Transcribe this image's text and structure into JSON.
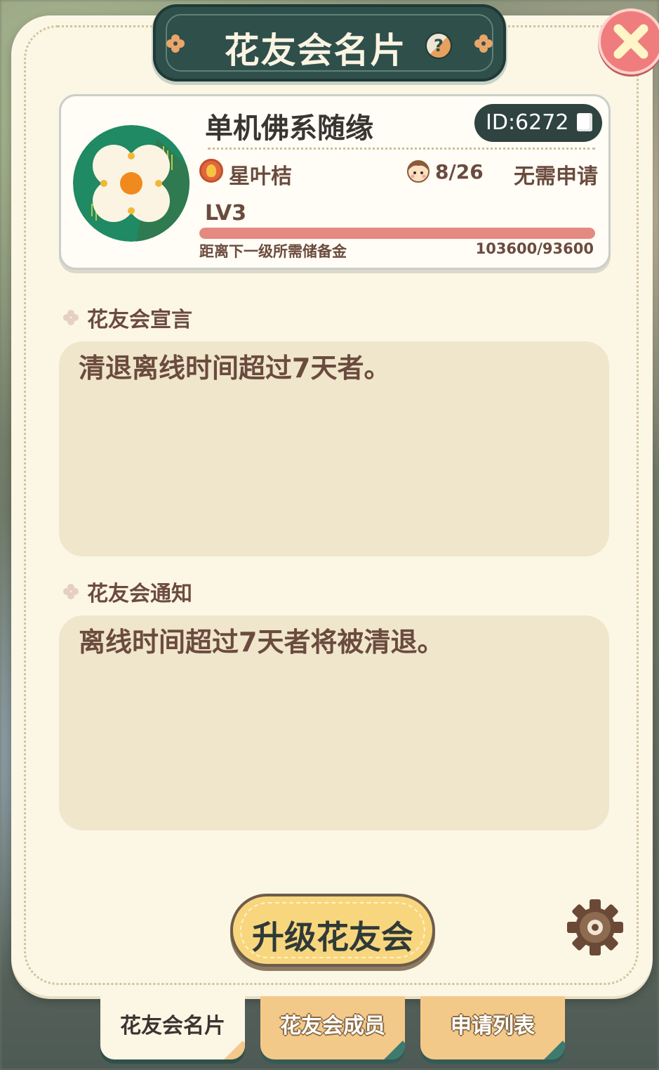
{
  "header": {
    "title": "花友会名片",
    "help_icon": "question-icon",
    "close_icon": "close-icon"
  },
  "club": {
    "name": "单机佛系随缘",
    "id_label": "ID:6272",
    "leader_name": "星叶桔",
    "member_count": "8/26",
    "join_policy": "无需申请",
    "level": "LV3",
    "progress_label": "距离下一级所需储备金",
    "progress_value": "103600/93600",
    "progress_fraction": 1.0
  },
  "declaration": {
    "title": "花友会宣言",
    "text": "清退离线时间超过7天者。"
  },
  "notice": {
    "title": "花友会通知",
    "text": "离线时间超过7天者将被清退。"
  },
  "actions": {
    "upgrade_label": "升级花友会",
    "settings_icon": "gear-icon"
  },
  "tabs": [
    {
      "label": "花友会名片",
      "active": true
    },
    {
      "label": "花友会成员",
      "active": false
    },
    {
      "label": "申请列表",
      "active": false
    }
  ],
  "colors": {
    "panel": "#fcf6e4",
    "banner": "#2f4f4a",
    "accent_text": "#6b4b3e",
    "progress": "#e58a80",
    "button": "#f8d67e",
    "close": "#f07d7d"
  }
}
